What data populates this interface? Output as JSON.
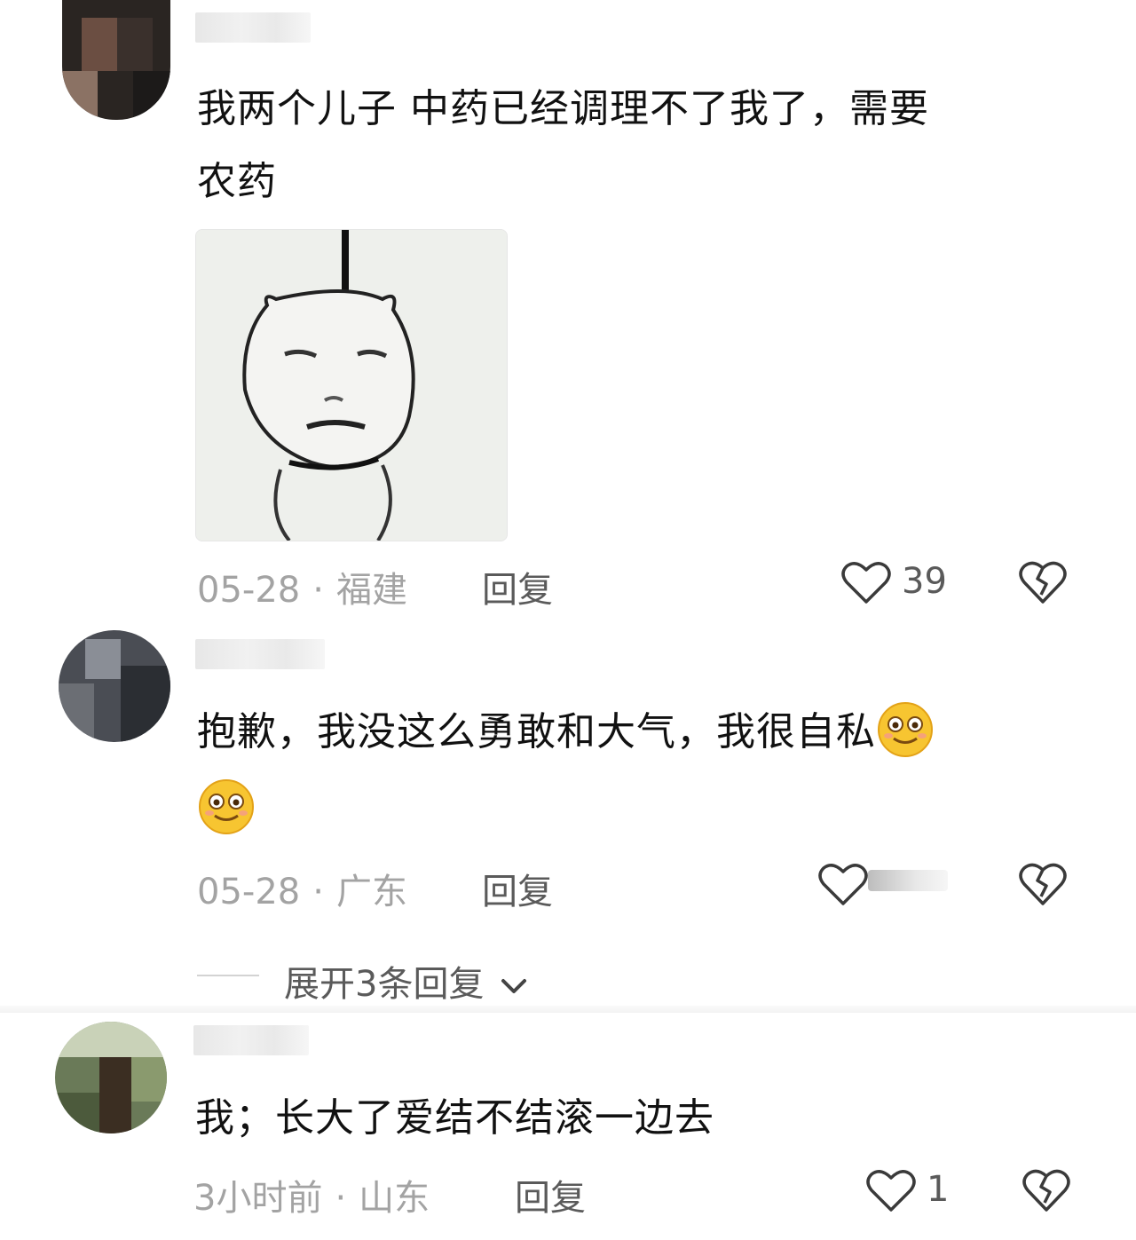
{
  "comments": [
    {
      "text_line1": "我两个儿子 中药已经调理不了我了，需要",
      "text_line2": "农药",
      "date": "05-28",
      "location": "福建",
      "reply_label": "回复",
      "likes": "39"
    },
    {
      "text_line1": "抱歉，我没这么勇敢和大气，我很自私",
      "date": "05-28",
      "location": "广东",
      "reply_label": "回复",
      "likes": ""
    },
    {
      "text_line1": "我；长大了爱结不结滚一边去",
      "date": "3小时前",
      "location": "山东",
      "reply_label": "回复",
      "likes": "1"
    }
  ],
  "expand_replies": "展开3条回复",
  "meta_separator": "·",
  "icons": {
    "like": "heart-outline-icon",
    "dislike": "broken-heart-icon",
    "emoji": "smiling-face-emoji",
    "expand": "chevron-down-icon"
  },
  "colors": {
    "text": "#111111",
    "meta": "#a3a3a3",
    "action": "#5a5a5a"
  }
}
